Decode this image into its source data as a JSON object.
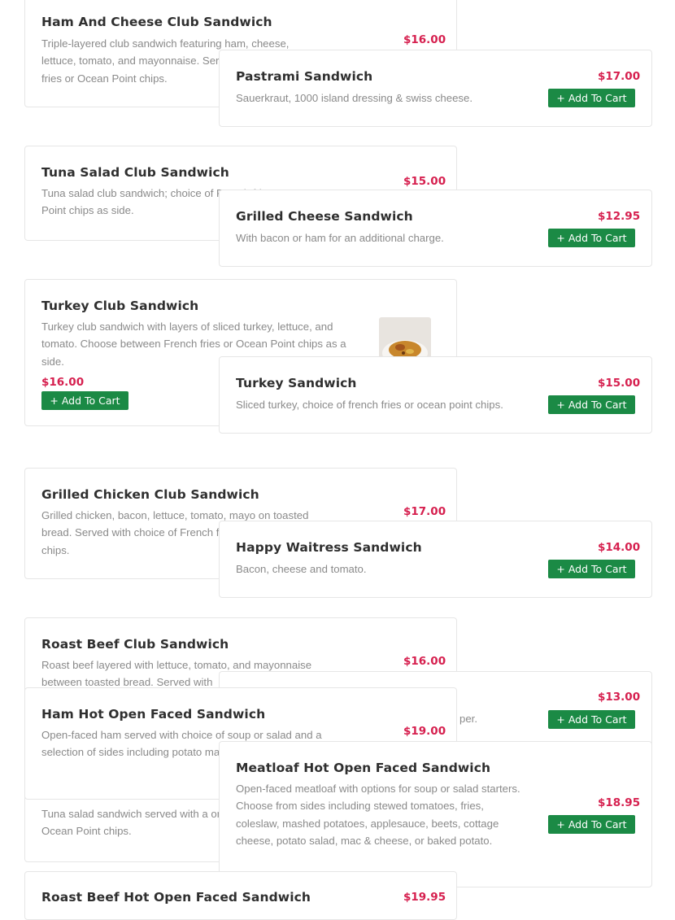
{
  "items": [
    {
      "title": "Ham And Cheese Club Sandwich",
      "desc": "Triple-layered club sandwich featuring ham, cheese, lettuce, tomato, and mayonnaise. Served with French fries or Ocean Point chips.",
      "price": "$16.00"
    },
    {
      "title": "Pastrami Sandwich",
      "desc": "Sauerkraut, 1000 island dressing & swiss cheese.",
      "price": "$17.00",
      "button": "+ Add To Cart"
    },
    {
      "title": "Tuna Salad Club Sandwich",
      "desc": "Tuna salad club sandwich; choice of French fries or Ocean Point chips as side.",
      "price": "$15.00"
    },
    {
      "title": "Grilled Cheese Sandwich",
      "desc": "With bacon or ham for an additional charge.",
      "price": "$12.95",
      "button": "+ Add To Cart"
    },
    {
      "title": "Turkey Club Sandwich",
      "desc": "Turkey club sandwich with layers of sliced turkey, lettuce, and tomato. Choose between French fries or Ocean Point chips as a side.",
      "price": "$16.00",
      "button": "+ Add To Cart"
    },
    {
      "title": "Turkey Sandwich",
      "desc": "Sliced turkey, choice of french fries or ocean point chips.",
      "price": "$15.00",
      "button": "+ Add To Cart"
    },
    {
      "title": "Grilled Chicken Club Sandwich",
      "desc": "Grilled chicken, bacon, lettuce, tomato, mayo on toasted bread. Served with choice of French fries or Ocean Point chips.",
      "price": "$17.00"
    },
    {
      "title": "Happy Waitress Sandwich",
      "desc": "Bacon, cheese and tomato.",
      "price": "$14.00",
      "button": "+ Add To Cart"
    },
    {
      "title": "Roast Beef Club Sandwich",
      "desc": "Roast beef layered with lettuce, tomato, and mayonnaise between toasted bread. Served with",
      "price": "$16.00"
    },
    {
      "title": "",
      "desc": "per.",
      "price": "$13.00",
      "button": "+ Add To Cart"
    },
    {
      "title": "Ham Hot Open Faced Sandwich",
      "desc": "Open-faced ham served with choice of soup or salad and a selection of sides including potato mac-n-cheese.",
      "price": "$19.00"
    },
    {
      "title": "",
      "desc": "Tuna salad sandwich served with a or Ocean Point chips.",
      "price": ""
    },
    {
      "title": "Meatloaf Hot Open Faced Sandwich",
      "desc": "Open-faced meatloaf with options for soup or salad starters. Choose from sides including stewed tomatoes, fries, coleslaw, mashed potatoes, applesauce, beets, cottage cheese, potato salad, mac & cheese, or baked potato.",
      "price": "$18.95",
      "button": "+ Add To Cart"
    },
    {
      "title": "Roast Beef Hot Open Faced Sandwich",
      "desc": "",
      "price": "$19.95"
    }
  ],
  "colors": {
    "price": "#d6204f",
    "button": "#1b8a45"
  }
}
